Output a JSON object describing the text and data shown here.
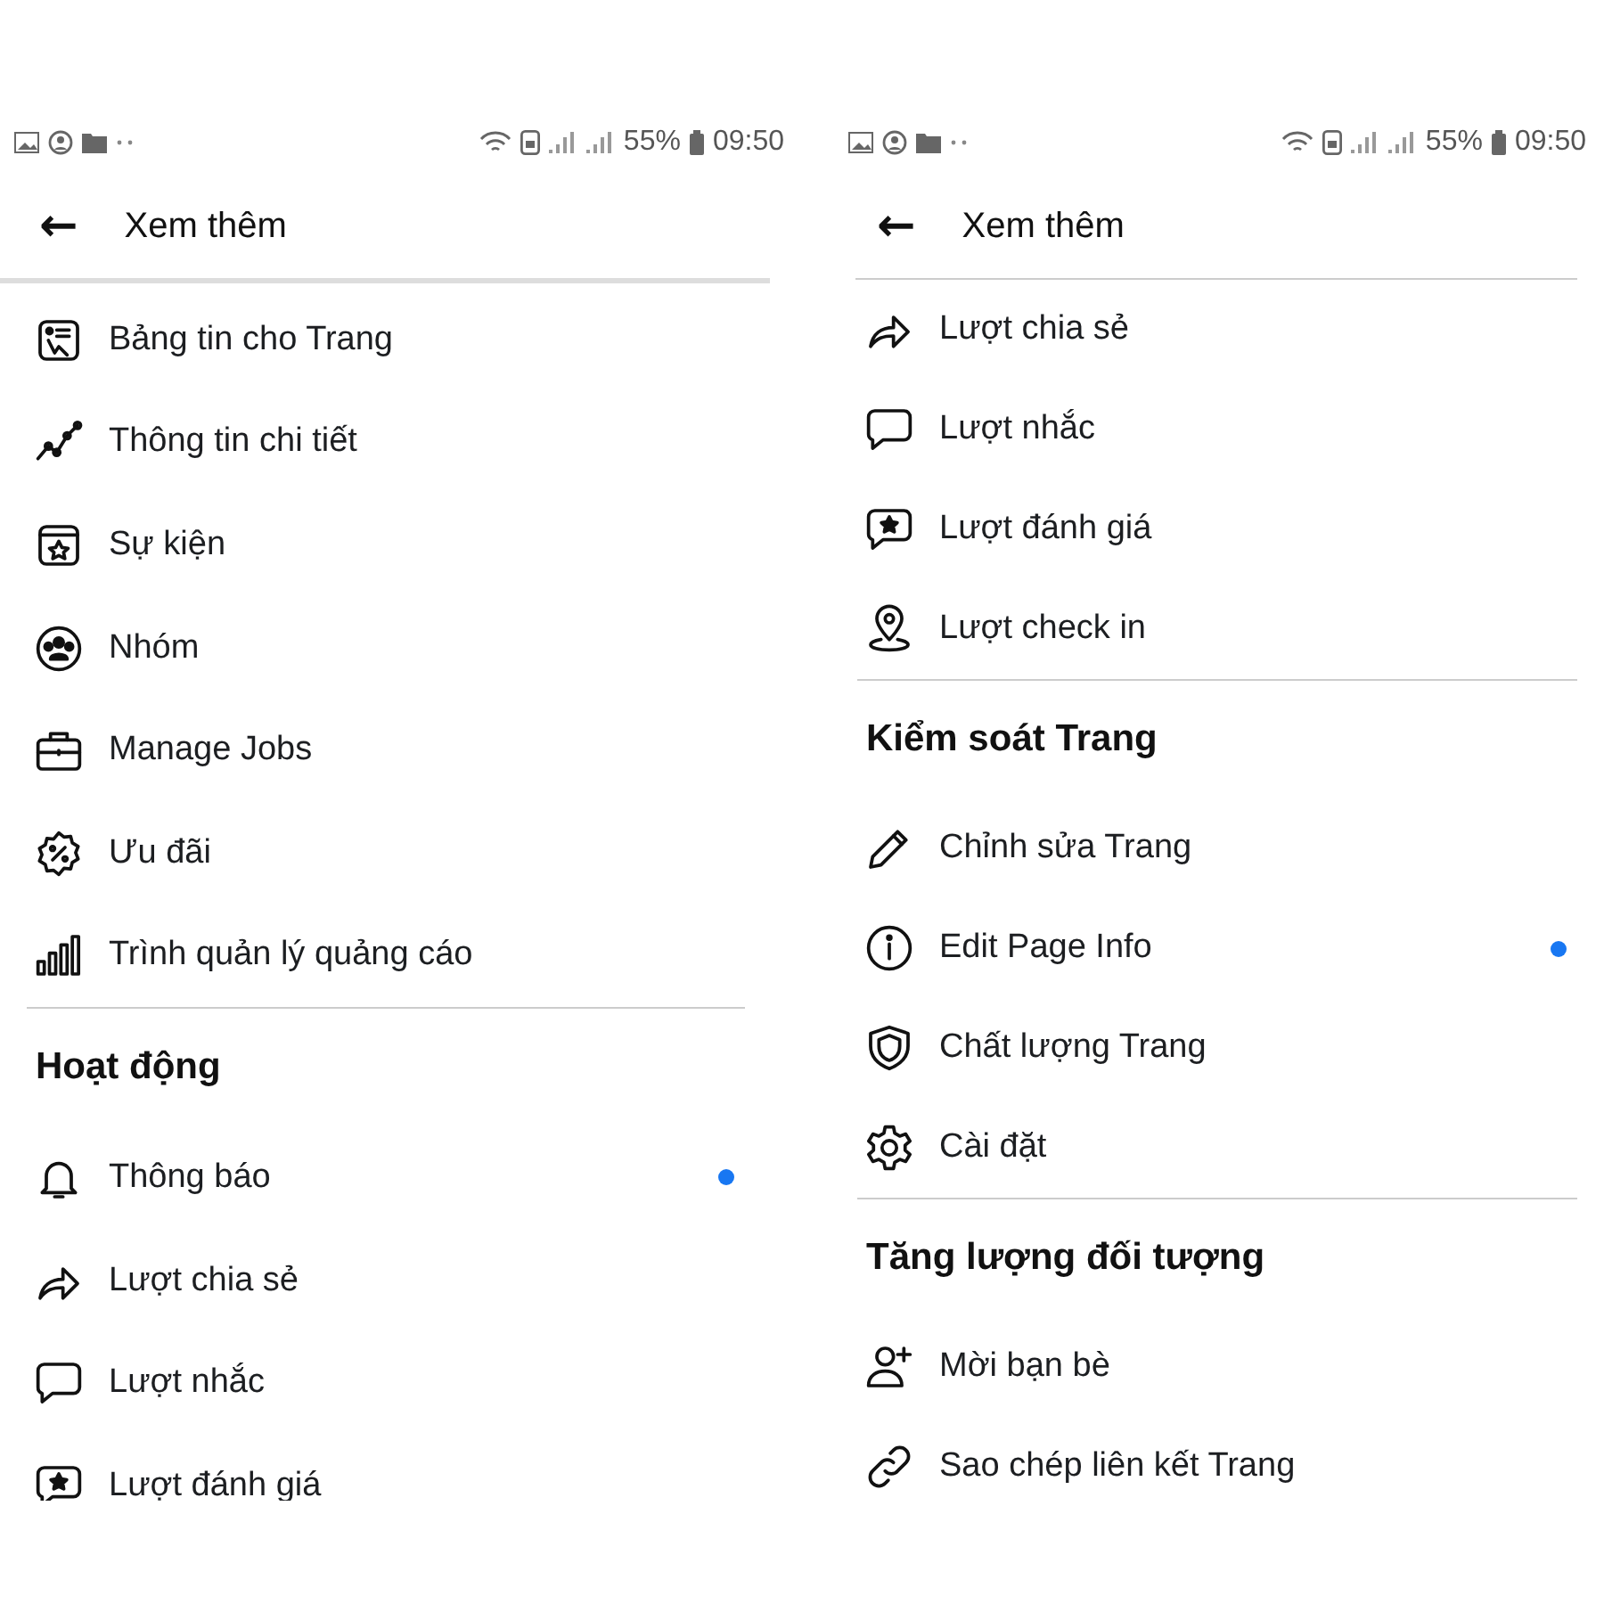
{
  "panels": [
    {
      "status_bar": {
        "battery": "55%",
        "time": "09:50"
      },
      "header": {
        "back": "←",
        "title": "Xem thêm"
      },
      "entries": [
        {
          "kind": "item",
          "label": "Bảng tin cho Trang",
          "unread": false
        },
        {
          "kind": "item",
          "label": "Thông tin chi tiết",
          "unread": false
        },
        {
          "kind": "item",
          "label": "Sự kiện",
          "unread": false
        },
        {
          "kind": "item",
          "label": "Nhóm",
          "unread": false
        },
        {
          "kind": "item",
          "label": "Manage Jobs",
          "unread": false
        },
        {
          "kind": "item",
          "label": "Ưu đãi",
          "unread": false
        },
        {
          "kind": "item",
          "label": "Trình quản lý quảng cáo",
          "unread": false
        },
        {
          "kind": "heading",
          "label": "Hoạt động"
        },
        {
          "kind": "item",
          "label": "Thông báo",
          "unread": true
        },
        {
          "kind": "item",
          "label": "Lượt chia sẻ",
          "unread": false
        },
        {
          "kind": "item",
          "label": "Lượt nhắc",
          "unread": false
        },
        {
          "kind": "item",
          "label": "Lượt đánh giá",
          "unread": false
        }
      ]
    },
    {
      "status_bar": {
        "battery": "55%",
        "time": "09:50"
      },
      "header": {
        "back": "←",
        "title": "Xem thêm"
      },
      "entries": [
        {
          "kind": "item",
          "label": "Lượt chia sẻ",
          "unread": false
        },
        {
          "kind": "item",
          "label": "Lượt nhắc",
          "unread": false
        },
        {
          "kind": "item",
          "label": "Lượt đánh giá",
          "unread": false
        },
        {
          "kind": "item",
          "label": "Lượt check in",
          "unread": false
        },
        {
          "kind": "heading",
          "label": "Kiểm soát Trang"
        },
        {
          "kind": "item",
          "label": "Chỉnh sửa Trang",
          "unread": false
        },
        {
          "kind": "item",
          "label": "Edit Page Info",
          "unread": true
        },
        {
          "kind": "item",
          "label": "Chất lượng Trang",
          "unread": false
        },
        {
          "kind": "item",
          "label": "Cài đặt",
          "unread": false
        },
        {
          "kind": "heading",
          "label": "Tăng lượng đối tượng"
        },
        {
          "kind": "item",
          "label": "Mời bạn bè",
          "unread": false
        },
        {
          "kind": "item",
          "label": "Sao chép liên kết Trang",
          "unread": false
        }
      ]
    }
  ]
}
